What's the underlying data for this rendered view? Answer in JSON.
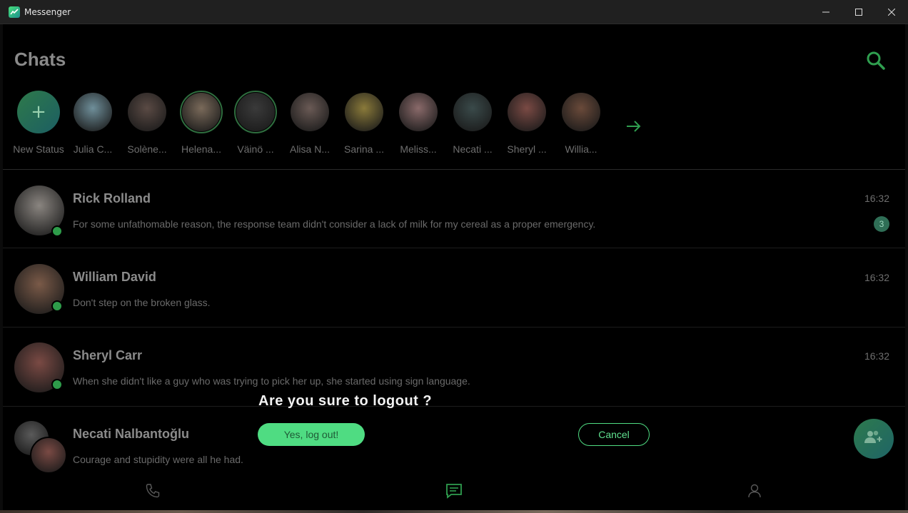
{
  "window": {
    "title": "Messenger",
    "controls": [
      "minimize-icon",
      "maximize-icon",
      "close-icon"
    ]
  },
  "header": {
    "title": "Chats",
    "search_icon": "search-icon",
    "accent": "#2f9e4f"
  },
  "stories": {
    "new_status": {
      "label": "New Status",
      "icon": "plus-icon"
    },
    "items": [
      {
        "label": "Julia C...",
        "ring": false,
        "tone": "#6f8f9a"
      },
      {
        "label": "Solène...",
        "ring": false,
        "tone": "#5a4a44"
      },
      {
        "label": "Helena...",
        "ring": true,
        "tone": "#7a6a5a"
      },
      {
        "label": "Väinö ...",
        "ring": true,
        "tone": "#3a3a3a"
      },
      {
        "label": "Alisa N...",
        "ring": false,
        "tone": "#6a5a55"
      },
      {
        "label": "Sarina ...",
        "ring": false,
        "tone": "#8a7a3a"
      },
      {
        "label": "Meliss...",
        "ring": false,
        "tone": "#8a6a6a"
      },
      {
        "label": "Necati ...",
        "ring": false,
        "tone": "#3a4a4a"
      },
      {
        "label": "Sheryl ...",
        "ring": false,
        "tone": "#7a4a44"
      },
      {
        "label": "Willia...",
        "ring": false,
        "tone": "#6a4a3a"
      }
    ],
    "next_icon": "arrow-right-icon"
  },
  "chats": [
    {
      "name": "Rick Rolland",
      "time": "16:32",
      "message": "For some unfathomable reason, the response team didn't consider a lack of milk for my cereal as a proper emergency.",
      "unread": "3",
      "online": true,
      "tone": "#8a8580"
    },
    {
      "name": "William David",
      "time": "16:32",
      "message": "Don't step on the broken glass.",
      "unread": null,
      "online": true,
      "tone": "#7a5a48"
    },
    {
      "name": "Sheryl Carr",
      "time": "16:32",
      "message": "When she didn't like a guy who was trying to pick her up, she started using sign language.",
      "unread": null,
      "online": true,
      "tone": "#7a4a44"
    },
    {
      "name": "Necati Nalbantoğlu",
      "time": "",
      "message": "Courage and stupidity were all he had.",
      "unread": null,
      "online": false,
      "tone": "#5a5a5a"
    }
  ],
  "dialog": {
    "title": "Are you sure to logout ?",
    "confirm_label": "Yes, log out!",
    "cancel_label": "Cancel",
    "confirm_color": "#4fdc82"
  },
  "nav": {
    "items": [
      "phone-icon",
      "chat-icon",
      "profile-icon"
    ],
    "active": "chat-icon"
  },
  "fab": {
    "icon": "add-user-icon"
  }
}
